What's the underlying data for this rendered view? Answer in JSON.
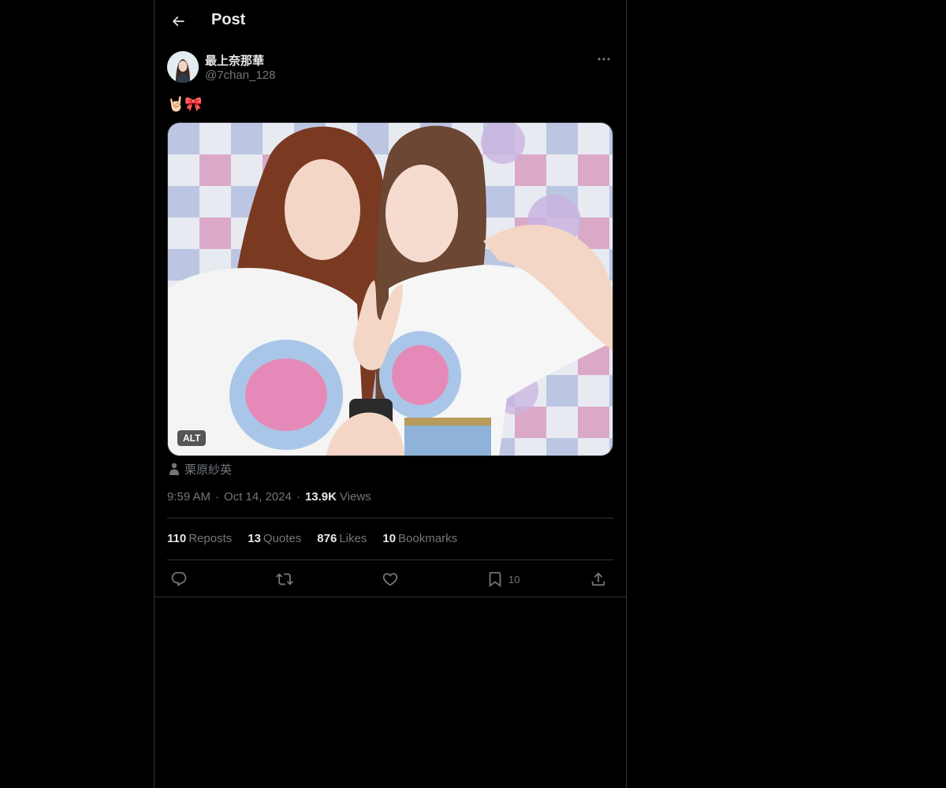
{
  "header": {
    "title": "Post",
    "back_icon": "arrow-left-icon"
  },
  "author": {
    "display_name": "最上奈那華",
    "handle": "@7chan_128"
  },
  "post": {
    "text": "🤘🏻🎀"
  },
  "media": {
    "alt_badge": "ALT"
  },
  "tagged": {
    "name": "栗原紗英"
  },
  "meta": {
    "time": "9:59 AM",
    "separator": "·",
    "date": "Oct 14, 2024",
    "views_count": "13.9K",
    "views_label": "Views"
  },
  "stats": [
    {
      "count": "110",
      "label": "Reposts"
    },
    {
      "count": "13",
      "label": "Quotes"
    },
    {
      "count": "876",
      "label": "Likes"
    },
    {
      "count": "10",
      "label": "Bookmarks"
    }
  ],
  "actions": {
    "bookmark_count": "10"
  },
  "colors": {
    "background": "#000000",
    "text": "#e7e9ea",
    "secondary": "#71767b",
    "border": "#2f3336"
  }
}
